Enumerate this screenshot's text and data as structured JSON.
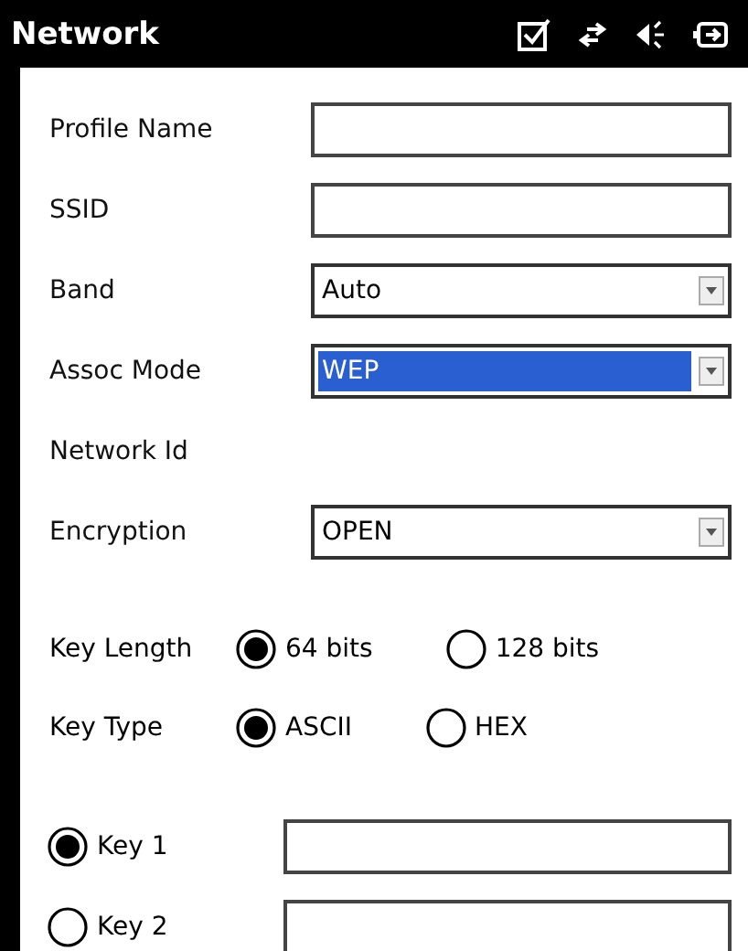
{
  "title_bar": {
    "title": "Network"
  },
  "fields": [
    {
      "kind": "text",
      "label": "Profile Name"
    },
    {
      "kind": "text",
      "label": "SSID"
    },
    {
      "kind": "dropdown",
      "label": "Band",
      "value": "Auto",
      "selected": false
    },
    {
      "kind": "dropdown",
      "label": "Assoc Mode",
      "value": "WEP",
      "selected": true
    },
    {
      "kind": "label",
      "label": "Network Id"
    },
    {
      "kind": "dropdown",
      "label": "Encryption",
      "value": "OPEN",
      "selected": false
    }
  ],
  "radio_groups": [
    {
      "label": "Key Length",
      "options": [
        {
          "label": "64 bits",
          "selected": true
        },
        {
          "label": "128 bits",
          "selected": false
        }
      ]
    },
    {
      "label": "Key Type",
      "options": [
        {
          "label": "ASCII",
          "selected": true
        },
        {
          "label": "HEX",
          "selected": false
        }
      ]
    }
  ],
  "keys": [
    {
      "label": "Key 1",
      "selected": true
    },
    {
      "label": "Key 2",
      "selected": false
    }
  ]
}
